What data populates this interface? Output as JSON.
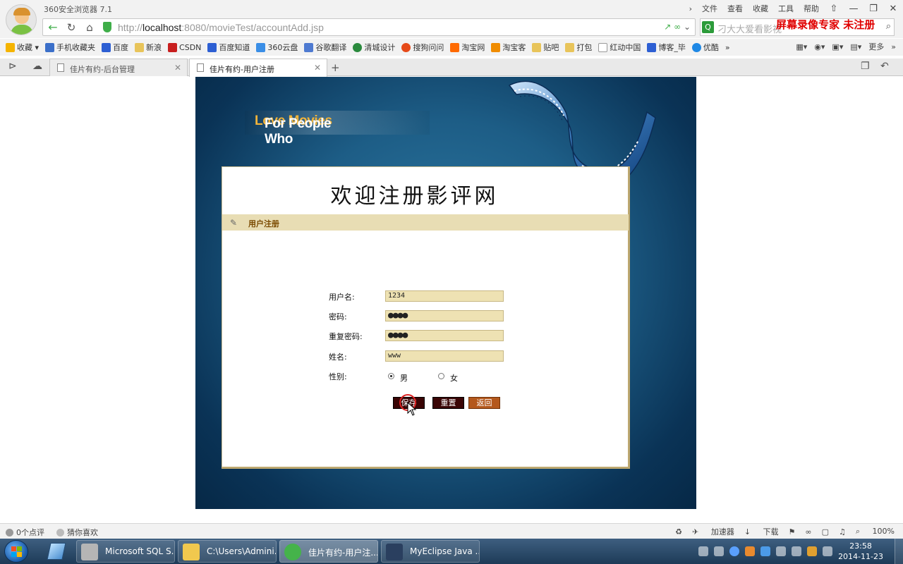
{
  "browser": {
    "app_title": "360安全浏览器 7.1",
    "menu": [
      "文件",
      "查看",
      "收藏",
      "工具",
      "帮助"
    ],
    "url_host": "http://",
    "url_domain": "localhost",
    "url_rest": ":8080/movieTest/accountAdd.jsp",
    "search_placeholder": "刁大大爱看影视",
    "watermark": "屏幕录像专家  未注册",
    "bookmarks": [
      "收藏",
      "手机收藏夹",
      "百度",
      "新浪",
      "CSDN",
      "百度知道",
      "360云盘",
      "谷歌翻译",
      "清城设计",
      "搜狗问问",
      "淘宝网",
      "淘宝客",
      "贴吧",
      "打包",
      "红动中国",
      "博客_毕",
      "优酷"
    ],
    "bookmarks_more": "更多",
    "tabs": [
      {
        "label": "佳片有约-后台管理",
        "active": false
      },
      {
        "label": "佳片有约-用户注册",
        "active": true
      }
    ]
  },
  "page": {
    "banner_prefix": "For People Who ",
    "banner_accent": "Love Movies",
    "welcome": "欢迎注册影评网",
    "section_title": "用户注册",
    "form": {
      "username_label": "用户名:",
      "username_value": "1234",
      "password_label": "密码:",
      "password_value": "●●●●",
      "repeat_label": "重复密码:",
      "repeat_value": "●●●●",
      "name_label": "姓名:",
      "name_value": "www",
      "gender_label": "性别:",
      "gender_options": [
        "男",
        "女"
      ],
      "gender_selected": "男"
    },
    "buttons": {
      "save": "保存",
      "reset": "重置",
      "back": "返回"
    }
  },
  "statusbar": {
    "comments": "0个点评",
    "guess": "猜你喜欢",
    "accelerator": "加速器",
    "download": "下载",
    "zoom": "100%"
  },
  "taskbar": {
    "tasks": [
      "Microsoft SQL S...",
      "C:\\Users\\Admini...",
      "佳片有约-用户注...",
      "MyEclipse Java ..."
    ],
    "time": "23:58",
    "date": "2014-11-23"
  },
  "colors": {
    "form_input_bg": "#eee2b3",
    "section_bar": "#e8ddb4",
    "button_dark": "#3a0505",
    "button_orange": "#b4581c",
    "stage_blue": "#1d5d86",
    "watermark_red": "#e00000"
  }
}
